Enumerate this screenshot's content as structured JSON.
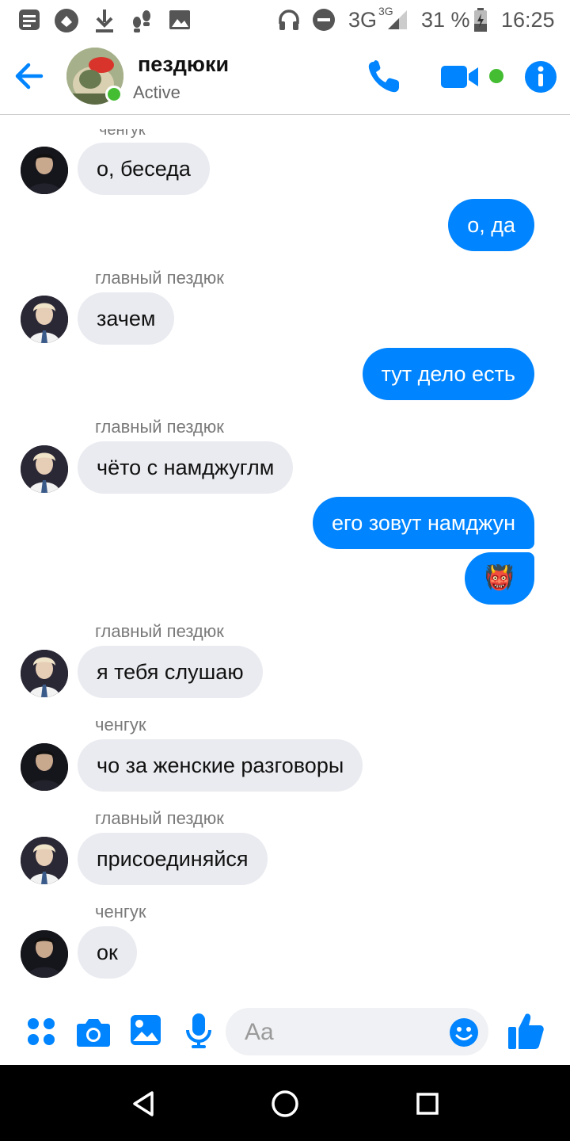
{
  "status_bar": {
    "network": "3G",
    "network_sup": "3G",
    "battery": "31 %",
    "time": "16:25"
  },
  "header": {
    "title": "пездюки",
    "subtitle": "Active"
  },
  "messages": {
    "cut_sender": "ченгук",
    "m1": "о, беседа",
    "m2": "о, да",
    "s3": "главный пездюк",
    "m3": "зачем",
    "m4": "тут дело есть",
    "s5": "главный пездюк",
    "m5": "чёто с намджуглм",
    "m6": "его зовут намджун",
    "m7_emoji": "👹",
    "s8": "главный пездюк",
    "m8": "я тебя слушаю",
    "s9": "ченгук",
    "m9": "чо за женские разговоры",
    "s10": "главный пездюк",
    "m10": "присоединяйся",
    "s11": "ченгук",
    "m11": "ок"
  },
  "composer": {
    "placeholder": "Aa"
  },
  "colors": {
    "accent": "#0084ff",
    "incoming_bubble": "#eaebf0",
    "active_green": "#44bd32"
  },
  "icons": [
    "back-arrow-icon",
    "phone-icon",
    "video-icon",
    "info-icon",
    "apps-icon",
    "camera-icon",
    "gallery-icon",
    "mic-icon",
    "emoji-icon",
    "thumbs-up-icon"
  ]
}
